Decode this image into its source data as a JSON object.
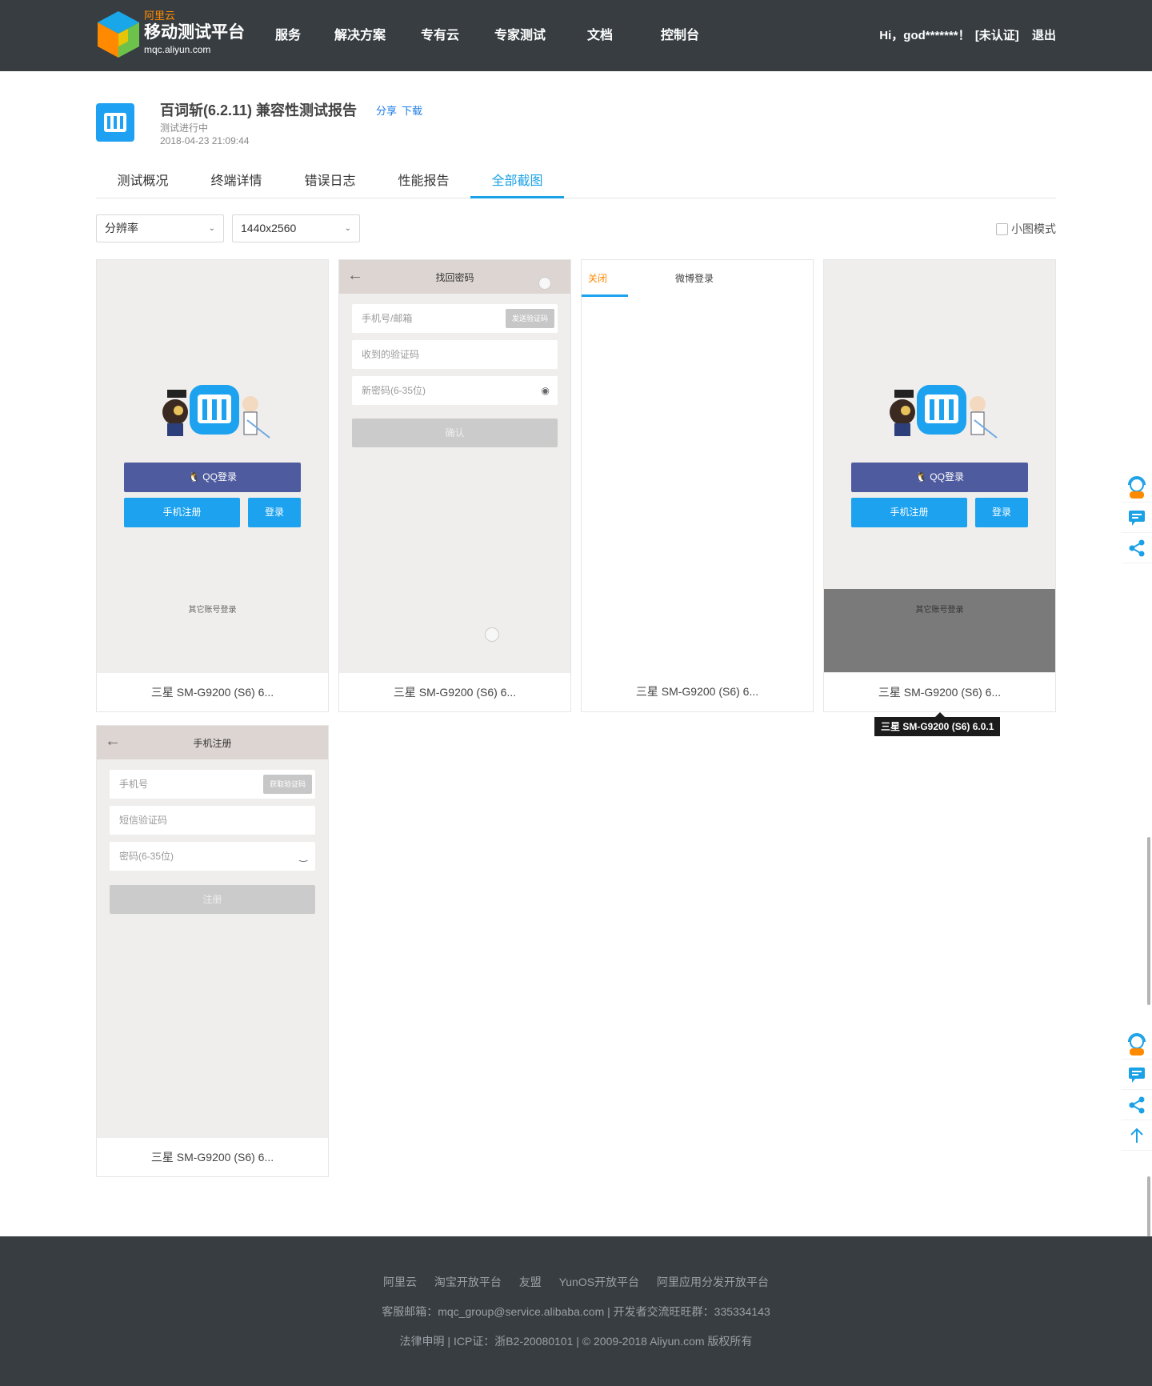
{
  "header": {
    "brand_top": "阿里云",
    "brand_name": "移动测试平台",
    "brand_domain": "mqc.aliyun.com",
    "nav": [
      "服务",
      "解决方案",
      "专有云",
      "专家测试",
      "文档",
      "控制台"
    ],
    "user_greeting": "Hi，god*******！",
    "user_status": "[未认证]",
    "logout": "退出"
  },
  "report": {
    "title": "百词斩(6.2.11) 兼容性测试报告",
    "share": "分享",
    "download": "下载",
    "status": "测试进行中",
    "time": "2018-04-23 21:09:44"
  },
  "tabs": [
    "测试概况",
    "终端详情",
    "错误日志",
    "性能报告",
    "全部截图"
  ],
  "active_tab": "全部截图",
  "filters": {
    "resolution_label": "分辨率",
    "resolution_value": "1440x2560",
    "small_mode": "小图模式"
  },
  "cards": [
    {
      "caption": "三星 SM-G9200 (S6) 6...",
      "qq": "QQ登录",
      "register": "手机注册",
      "login": "登录",
      "other": "其它账号登录"
    },
    {
      "caption": "三星 SM-G9200 (S6) 6...",
      "title": "找回密码",
      "f1": "手机号/邮箱",
      "f1_btn": "发送验证码",
      "f2": "收到的验证码",
      "f3": "新密码(6-35位)",
      "btn": "确认"
    },
    {
      "caption": "三星 SM-G9200 (S6) 6...",
      "close": "关闭",
      "weibo": "微博登录"
    },
    {
      "caption": "三星 SM-G9200 (S6) 6...",
      "qq": "QQ登录",
      "register": "手机注册",
      "login": "登录",
      "other": "其它账号登录"
    },
    {
      "caption": "三星 SM-G9200 (S6) 6...",
      "title": "手机注册",
      "f1": "手机号",
      "f1_btn": "获取验证码",
      "f2": "短信验证码",
      "f3": "密码(6-35位)",
      "btn": "注册"
    }
  ],
  "tooltip": "三星 SM-G9200 (S6) 6.0.1",
  "footer": {
    "links": [
      "阿里云",
      "淘宝开放平台",
      "友盟",
      "YunOS开放平台",
      "阿里应用分发开放平台"
    ],
    "contact": "客服邮箱：mqc_group@service.alibaba.com | 开发者交流旺旺群：335334143",
    "legal": "法律申明 | ICP证：浙B2-20080101 | © 2009-2018 Aliyun.com 版权所有"
  },
  "colors": {
    "header_bg": "#373d41",
    "accent": "#1ba1e6",
    "qq_button": "#4e5b9e",
    "primary_button": "#1ca2ef",
    "orange": "#ff8a00"
  }
}
